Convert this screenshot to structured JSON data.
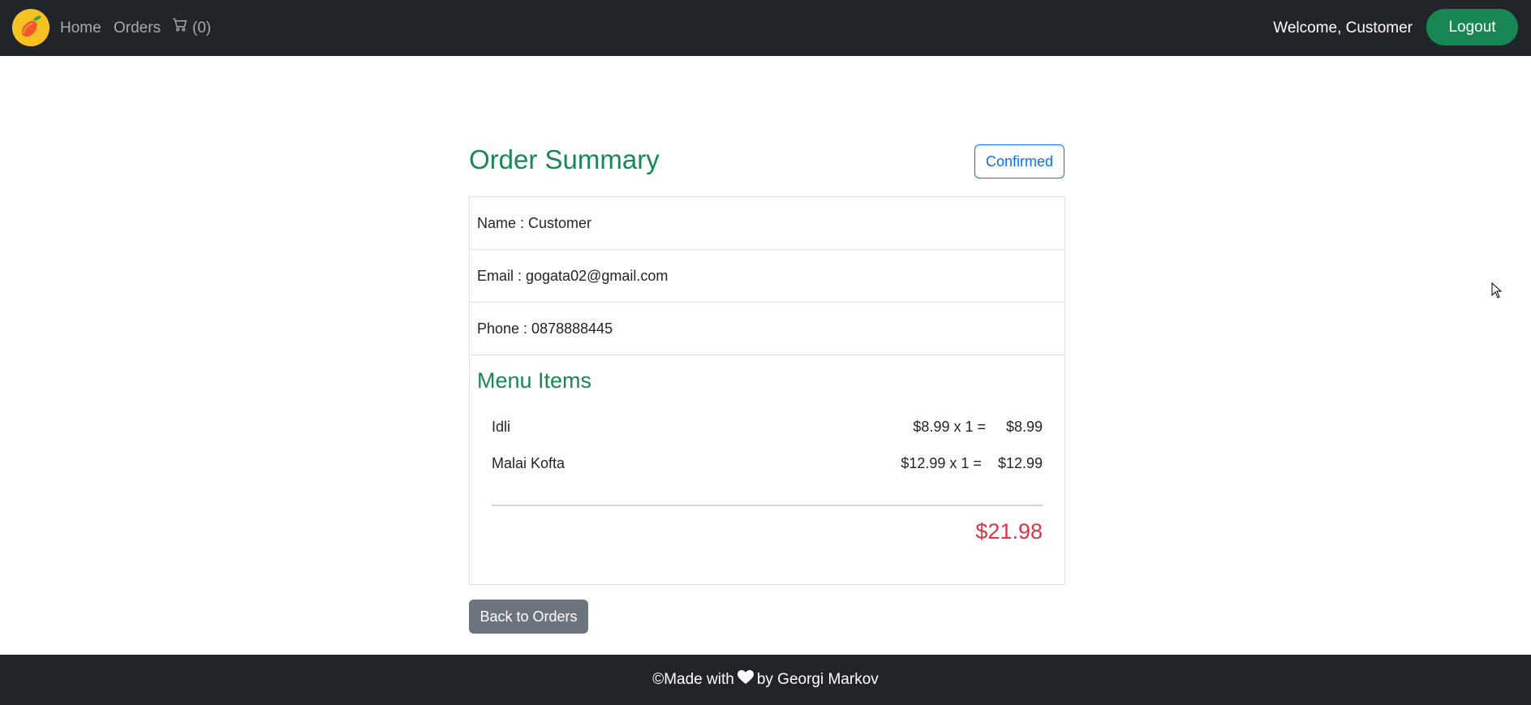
{
  "navbar": {
    "logo_icon": "mango-logo-icon",
    "links": {
      "home": "Home",
      "orders": "Orders"
    },
    "cart": {
      "icon": "cart-icon",
      "count": "(0)"
    },
    "welcome_text": "Welcome, Customer",
    "logout_label": "Logout"
  },
  "order": {
    "title": "Order Summary",
    "status": "Confirmed",
    "name_line": "Name : Customer",
    "email_line": "Email : gogata02@gmail.com",
    "phone_line": "Phone : 0878888445",
    "menu_title": "Menu Items",
    "items": [
      {
        "name": "Idli",
        "price_qty": "$8.99 x 1 =",
        "subtotal": "$8.99"
      },
      {
        "name": "Malai Kofta",
        "price_qty": "$12.99 x 1 =",
        "subtotal": "$12.99"
      }
    ],
    "total": "$21.98"
  },
  "back_button_label": "Back to Orders",
  "footer": {
    "prefix": "©Made with",
    "heart_icon": "heart-icon",
    "suffix": "by Georgi Markov"
  },
  "colors": {
    "navbar_bg": "#212529",
    "success_green": "#198754",
    "primary_blue": "#0d6efd",
    "danger_red": "#dc3545",
    "secondary_gray": "#6c757d"
  }
}
